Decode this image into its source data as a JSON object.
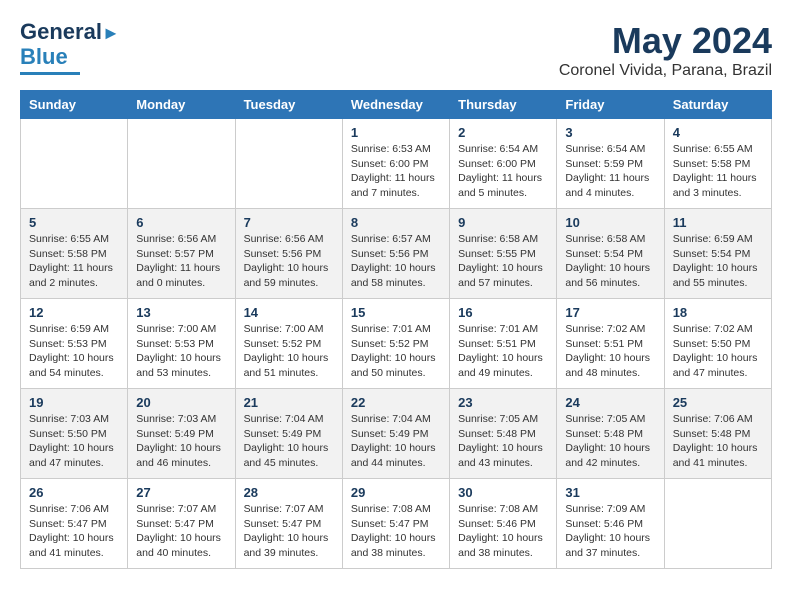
{
  "header": {
    "logo_line1": "General",
    "logo_line2": "Blue",
    "month": "May 2024",
    "location": "Coronel Vivida, Parana, Brazil"
  },
  "days_of_week": [
    "Sunday",
    "Monday",
    "Tuesday",
    "Wednesday",
    "Thursday",
    "Friday",
    "Saturday"
  ],
  "weeks": [
    [
      {
        "day": "",
        "text": ""
      },
      {
        "day": "",
        "text": ""
      },
      {
        "day": "",
        "text": ""
      },
      {
        "day": "1",
        "text": "Sunrise: 6:53 AM\nSunset: 6:00 PM\nDaylight: 11 hours\nand 7 minutes."
      },
      {
        "day": "2",
        "text": "Sunrise: 6:54 AM\nSunset: 6:00 PM\nDaylight: 11 hours\nand 5 minutes."
      },
      {
        "day": "3",
        "text": "Sunrise: 6:54 AM\nSunset: 5:59 PM\nDaylight: 11 hours\nand 4 minutes."
      },
      {
        "day": "4",
        "text": "Sunrise: 6:55 AM\nSunset: 5:58 PM\nDaylight: 11 hours\nand 3 minutes."
      }
    ],
    [
      {
        "day": "5",
        "text": "Sunrise: 6:55 AM\nSunset: 5:58 PM\nDaylight: 11 hours\nand 2 minutes."
      },
      {
        "day": "6",
        "text": "Sunrise: 6:56 AM\nSunset: 5:57 PM\nDaylight: 11 hours\nand 0 minutes."
      },
      {
        "day": "7",
        "text": "Sunrise: 6:56 AM\nSunset: 5:56 PM\nDaylight: 10 hours\nand 59 minutes."
      },
      {
        "day": "8",
        "text": "Sunrise: 6:57 AM\nSunset: 5:56 PM\nDaylight: 10 hours\nand 58 minutes."
      },
      {
        "day": "9",
        "text": "Sunrise: 6:58 AM\nSunset: 5:55 PM\nDaylight: 10 hours\nand 57 minutes."
      },
      {
        "day": "10",
        "text": "Sunrise: 6:58 AM\nSunset: 5:54 PM\nDaylight: 10 hours\nand 56 minutes."
      },
      {
        "day": "11",
        "text": "Sunrise: 6:59 AM\nSunset: 5:54 PM\nDaylight: 10 hours\nand 55 minutes."
      }
    ],
    [
      {
        "day": "12",
        "text": "Sunrise: 6:59 AM\nSunset: 5:53 PM\nDaylight: 10 hours\nand 54 minutes."
      },
      {
        "day": "13",
        "text": "Sunrise: 7:00 AM\nSunset: 5:53 PM\nDaylight: 10 hours\nand 53 minutes."
      },
      {
        "day": "14",
        "text": "Sunrise: 7:00 AM\nSunset: 5:52 PM\nDaylight: 10 hours\nand 51 minutes."
      },
      {
        "day": "15",
        "text": "Sunrise: 7:01 AM\nSunset: 5:52 PM\nDaylight: 10 hours\nand 50 minutes."
      },
      {
        "day": "16",
        "text": "Sunrise: 7:01 AM\nSunset: 5:51 PM\nDaylight: 10 hours\nand 49 minutes."
      },
      {
        "day": "17",
        "text": "Sunrise: 7:02 AM\nSunset: 5:51 PM\nDaylight: 10 hours\nand 48 minutes."
      },
      {
        "day": "18",
        "text": "Sunrise: 7:02 AM\nSunset: 5:50 PM\nDaylight: 10 hours\nand 47 minutes."
      }
    ],
    [
      {
        "day": "19",
        "text": "Sunrise: 7:03 AM\nSunset: 5:50 PM\nDaylight: 10 hours\nand 47 minutes."
      },
      {
        "day": "20",
        "text": "Sunrise: 7:03 AM\nSunset: 5:49 PM\nDaylight: 10 hours\nand 46 minutes."
      },
      {
        "day": "21",
        "text": "Sunrise: 7:04 AM\nSunset: 5:49 PM\nDaylight: 10 hours\nand 45 minutes."
      },
      {
        "day": "22",
        "text": "Sunrise: 7:04 AM\nSunset: 5:49 PM\nDaylight: 10 hours\nand 44 minutes."
      },
      {
        "day": "23",
        "text": "Sunrise: 7:05 AM\nSunset: 5:48 PM\nDaylight: 10 hours\nand 43 minutes."
      },
      {
        "day": "24",
        "text": "Sunrise: 7:05 AM\nSunset: 5:48 PM\nDaylight: 10 hours\nand 42 minutes."
      },
      {
        "day": "25",
        "text": "Sunrise: 7:06 AM\nSunset: 5:48 PM\nDaylight: 10 hours\nand 41 minutes."
      }
    ],
    [
      {
        "day": "26",
        "text": "Sunrise: 7:06 AM\nSunset: 5:47 PM\nDaylight: 10 hours\nand 41 minutes."
      },
      {
        "day": "27",
        "text": "Sunrise: 7:07 AM\nSunset: 5:47 PM\nDaylight: 10 hours\nand 40 minutes."
      },
      {
        "day": "28",
        "text": "Sunrise: 7:07 AM\nSunset: 5:47 PM\nDaylight: 10 hours\nand 39 minutes."
      },
      {
        "day": "29",
        "text": "Sunrise: 7:08 AM\nSunset: 5:47 PM\nDaylight: 10 hours\nand 38 minutes."
      },
      {
        "day": "30",
        "text": "Sunrise: 7:08 AM\nSunset: 5:46 PM\nDaylight: 10 hours\nand 38 minutes."
      },
      {
        "day": "31",
        "text": "Sunrise: 7:09 AM\nSunset: 5:46 PM\nDaylight: 10 hours\nand 37 minutes."
      },
      {
        "day": "",
        "text": ""
      }
    ]
  ]
}
